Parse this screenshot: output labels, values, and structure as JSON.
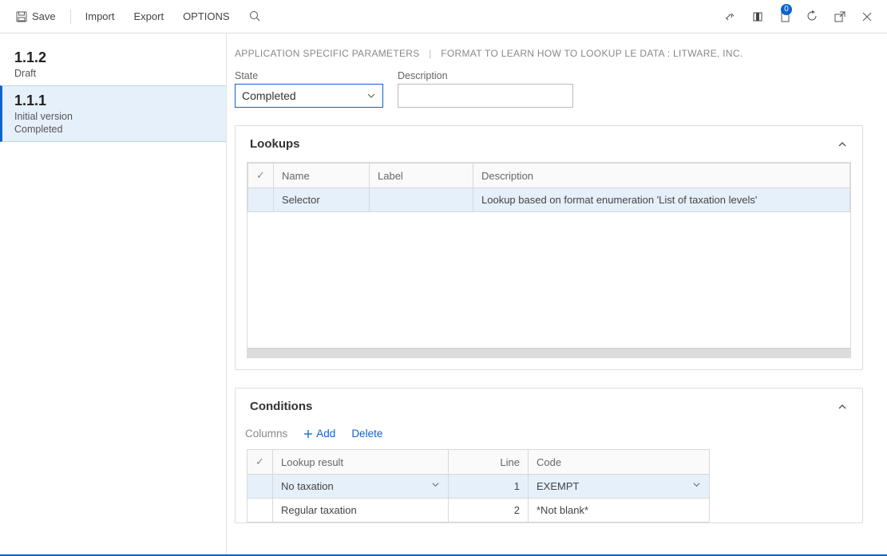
{
  "toolbar": {
    "save_label": "Save",
    "import_label": "Import",
    "export_label": "Export",
    "options_label": "OPTIONS",
    "notification_count": "0"
  },
  "sidebar": {
    "items": [
      {
        "version": "1.1.2",
        "lines": [
          "Draft"
        ],
        "selected": false
      },
      {
        "version": "1.1.1",
        "lines": [
          "Initial version",
          "Completed"
        ],
        "selected": true
      }
    ]
  },
  "breadcrumb": {
    "part1": "APPLICATION SPECIFIC PARAMETERS",
    "part2": "FORMAT TO LEARN HOW TO LOOKUP LE DATA : LITWARE, INC."
  },
  "fields": {
    "state_label": "State",
    "state_value": "Completed",
    "description_label": "Description",
    "description_value": ""
  },
  "lookups": {
    "title": "Lookups",
    "headers": {
      "name": "Name",
      "label": "Label",
      "description": "Description"
    },
    "rows": [
      {
        "name": "Selector",
        "label": "",
        "description": "Lookup based on format enumeration 'List of taxation levels'",
        "selected": true
      }
    ]
  },
  "conditions": {
    "title": "Conditions",
    "actions": {
      "columns": "Columns",
      "add": "Add",
      "delete": "Delete"
    },
    "headers": {
      "result": "Lookup result",
      "line": "Line",
      "code": "Code"
    },
    "rows": [
      {
        "result": "No taxation",
        "line": "1",
        "code": "EXEMPT",
        "selected": true,
        "dropdowns": true
      },
      {
        "result": "Regular taxation",
        "line": "2",
        "code": "*Not blank*",
        "selected": false,
        "dropdowns": false
      }
    ]
  }
}
